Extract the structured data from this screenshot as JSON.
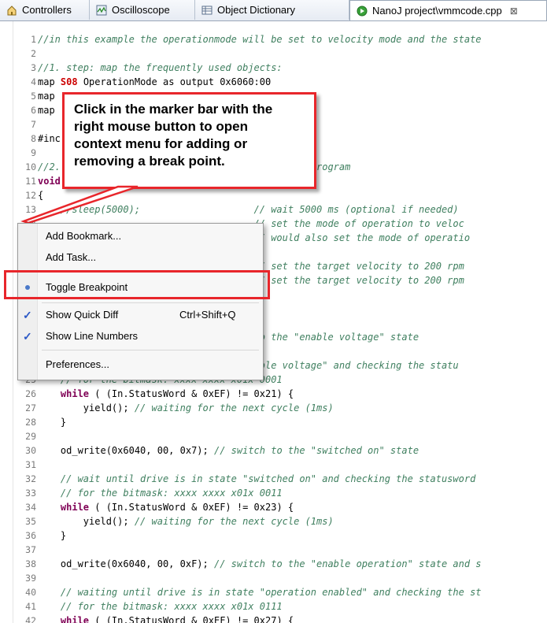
{
  "tabs": [
    {
      "label": "Controllers",
      "icon": "home-icon",
      "active": false
    },
    {
      "label": "Oscilloscope",
      "icon": "oscilloscope-icon",
      "active": false
    },
    {
      "label": "Object Dictionary",
      "icon": "table-icon",
      "active": false
    },
    {
      "label": "NanoJ project\\vmmcode.cpp",
      "icon": "run-file-icon",
      "active": true,
      "close": "⊠"
    }
  ],
  "code_lines": [
    {
      "n": "1",
      "parts": [
        {
          "c": "cm",
          "t": "//in this example the operationmode will be set to velocity mode and the state"
        }
      ]
    },
    {
      "n": "2",
      "parts": []
    },
    {
      "n": "3",
      "parts": [
        {
          "c": "cm",
          "t": "//1. step: map the frequently used objects:"
        }
      ]
    },
    {
      "n": "4",
      "parts": [
        {
          "c": "tx",
          "t": "map "
        },
        {
          "c": "hl",
          "t": "S08"
        },
        {
          "c": "tx",
          "t": " OperationMode as output 0x6060:00"
        }
      ]
    },
    {
      "n": "5",
      "parts": [
        {
          "c": "tx",
          "t": "map"
        }
      ]
    },
    {
      "n": "6",
      "parts": [
        {
          "c": "tx",
          "t": "map"
        }
      ]
    },
    {
      "n": "7",
      "parts": []
    },
    {
      "n": "8",
      "parts": [
        {
          "c": "tx",
          "t": "#inc"
        }
      ]
    },
    {
      "n": "9",
      "parts": []
    },
    {
      "n": "10",
      "parts": [
        {
          "c": "cm",
          "t": "//2.                                   t of the program"
        }
      ]
    },
    {
      "n": "11",
      "parts": [
        {
          "c": "kw",
          "t": "void"
        }
      ]
    },
    {
      "n": "12",
      "parts": [
        {
          "c": "tx",
          "t": "{"
        }
      ]
    },
    {
      "n": "13",
      "parts": [
        {
          "c": "cm",
          "t": "    //sleep(5000);                    // wait 5000 ms (optional if needed)"
        }
      ]
    },
    {
      "n": "14",
      "parts": [
        {
          "c": "cm",
          "t": "                                      // set the mode of operation to veloc"
        }
      ]
    },
    {
      "n": "15",
      "parts": [
        {
          "c": "cm",
          "t": "                                      // would also set the mode of operatio"
        }
      ]
    },
    {
      "n": "16",
      "parts": []
    },
    {
      "n": "17",
      "parts": [
        {
          "c": "cm",
          "t": "                                      // set the target velocity to 200 rpm"
        }
      ]
    },
    {
      "n": "18",
      "parts": [
        {
          "c": "cm",
          "t": "                                      // set the target velocity to 200 rpm"
        }
      ]
    },
    {
      "n": "19",
      "parts": []
    },
    {
      "n": "20",
      "parts": [
        {
          "c": "cm",
          "t": "                               machine"
        }
      ]
    },
    {
      "n": "21",
      "parts": []
    },
    {
      "n": "22",
      "parts": [
        {
          "c": "cm",
          "t": "                               switch to the \"enable voltage\" state"
        }
      ]
    },
    {
      "n": "23",
      "parts": []
    },
    {
      "n": "24",
      "parts": [
        {
          "c": "cm",
          "t": "                              tate \"enable voltage\" and checking the statu"
        }
      ]
    },
    {
      "n": "25",
      "parts": [
        {
          "c": "cm",
          "t": "    // for the bitmask: xxxx xxxx x01x 0001"
        }
      ]
    },
    {
      "n": "26",
      "parts": [
        {
          "c": "tx",
          "t": "    "
        },
        {
          "c": "kw",
          "t": "while"
        },
        {
          "c": "tx",
          "t": " ( (In.StatusWord & 0xEF) != 0x21) {"
        }
      ]
    },
    {
      "n": "27",
      "parts": [
        {
          "c": "tx",
          "t": "        yield(); "
        },
        {
          "c": "cm",
          "t": "// waiting for the next cycle (1ms)"
        }
      ]
    },
    {
      "n": "28",
      "parts": [
        {
          "c": "tx",
          "t": "    }"
        }
      ]
    },
    {
      "n": "29",
      "parts": []
    },
    {
      "n": "30",
      "parts": [
        {
          "c": "tx",
          "t": "    od_write(0x6040, 00, 0x7); "
        },
        {
          "c": "cm",
          "t": "// switch to the \"switched on\" state"
        }
      ]
    },
    {
      "n": "31",
      "parts": []
    },
    {
      "n": "32",
      "parts": [
        {
          "c": "cm",
          "t": "    // wait until drive is in state \"switched on\" and checking the statusword"
        }
      ]
    },
    {
      "n": "33",
      "parts": [
        {
          "c": "cm",
          "t": "    // for the bitmask: xxxx xxxx x01x 0011"
        }
      ]
    },
    {
      "n": "34",
      "parts": [
        {
          "c": "tx",
          "t": "    "
        },
        {
          "c": "kw",
          "t": "while"
        },
        {
          "c": "tx",
          "t": " ( (In.StatusWord & 0xEF) != 0x23) {"
        }
      ]
    },
    {
      "n": "35",
      "parts": [
        {
          "c": "tx",
          "t": "        yield(); "
        },
        {
          "c": "cm",
          "t": "// waiting for the next cycle (1ms)"
        }
      ]
    },
    {
      "n": "36",
      "parts": [
        {
          "c": "tx",
          "t": "    }"
        }
      ]
    },
    {
      "n": "37",
      "parts": []
    },
    {
      "n": "38",
      "parts": [
        {
          "c": "tx",
          "t": "    od_write(0x6040, 00, 0xF); "
        },
        {
          "c": "cm",
          "t": "// switch to the \"enable operation\" state and s"
        }
      ]
    },
    {
      "n": "39",
      "parts": []
    },
    {
      "n": "40",
      "parts": [
        {
          "c": "cm",
          "t": "    // waiting until drive is in state \"operation enabled\" and checking the st"
        }
      ]
    },
    {
      "n": "41",
      "parts": [
        {
          "c": "cm",
          "t": "    // for the bitmask: xxxx xxxx x01x 0111"
        }
      ]
    },
    {
      "n": "42",
      "parts": [
        {
          "c": "tx",
          "t": "    "
        },
        {
          "c": "kw",
          "t": "while"
        },
        {
          "c": "tx",
          "t": " ( (In.StatusWord & 0xEF) != 0x27) {"
        }
      ]
    }
  ],
  "callout": {
    "text": "Click in the marker bar with the\nright mouse button to open\ncontext menu for adding or\nremoving a break point."
  },
  "context_menu": {
    "items": [
      {
        "label": "Add Bookmark...",
        "shortcut": "",
        "mark": ""
      },
      {
        "label": "Add Task...",
        "shortcut": "",
        "mark": ""
      },
      {
        "label": "Toggle Breakpoint",
        "shortcut": "",
        "mark": "dot"
      },
      {
        "label": "Show Quick Diff",
        "shortcut": "Ctrl+Shift+Q",
        "mark": "check",
        "check_glyph": "✓"
      },
      {
        "label": "Show Line Numbers",
        "shortcut": "",
        "mark": "check",
        "check_glyph": "✓"
      },
      {
        "label": "Preferences...",
        "shortcut": "",
        "mark": ""
      }
    ]
  },
  "colors": {
    "highlight": "#e8262b",
    "comment": "#3f7f5f",
    "keyword": "#7f0055",
    "check": "#2b58c6"
  }
}
